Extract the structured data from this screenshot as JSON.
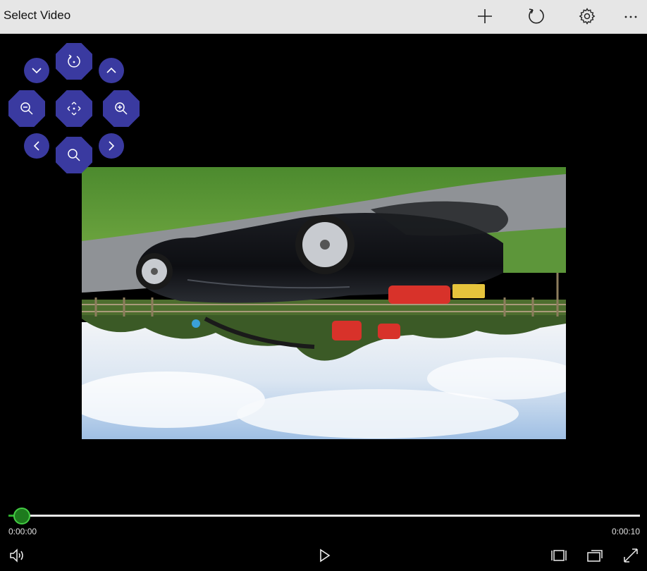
{
  "app": {
    "title": "Select Video"
  },
  "toolbar": {
    "add_icon": "plus-icon",
    "rotate_icon": "rotate-icon",
    "settings_icon": "gear-icon",
    "more_icon": "ellipsis-icon"
  },
  "pan_controls": [
    {
      "name": "scroll-down-button",
      "icon": "chevron-down-icon"
    },
    {
      "name": "rotate-view-button",
      "icon": "rotate-icon"
    },
    {
      "name": "scroll-up-button",
      "icon": "chevron-up-icon"
    },
    {
      "name": "zoom-out-button",
      "icon": "zoom-out-icon"
    },
    {
      "name": "center-button",
      "icon": "move-icon"
    },
    {
      "name": "zoom-in-button",
      "icon": "zoom-in-icon"
    },
    {
      "name": "pan-left-button",
      "icon": "chevron-left-icon"
    },
    {
      "name": "zoom-reset-button",
      "icon": "search-icon"
    },
    {
      "name": "pan-right-button",
      "icon": "chevron-right-icon"
    }
  ],
  "player": {
    "current_time": "0:00:00",
    "total_time": "0:00:10",
    "progress": 0.0,
    "colors": {
      "accent": "#2eae2e",
      "control_bg": "#3a3aa0"
    }
  },
  "bottom_controls": {
    "volume_icon": "volume-icon",
    "play_icon": "play-icon",
    "aspect_icon": "aspect-ratio-icon",
    "cast_icon": "cast-icon",
    "fullscreen_icon": "fullscreen-icon"
  }
}
